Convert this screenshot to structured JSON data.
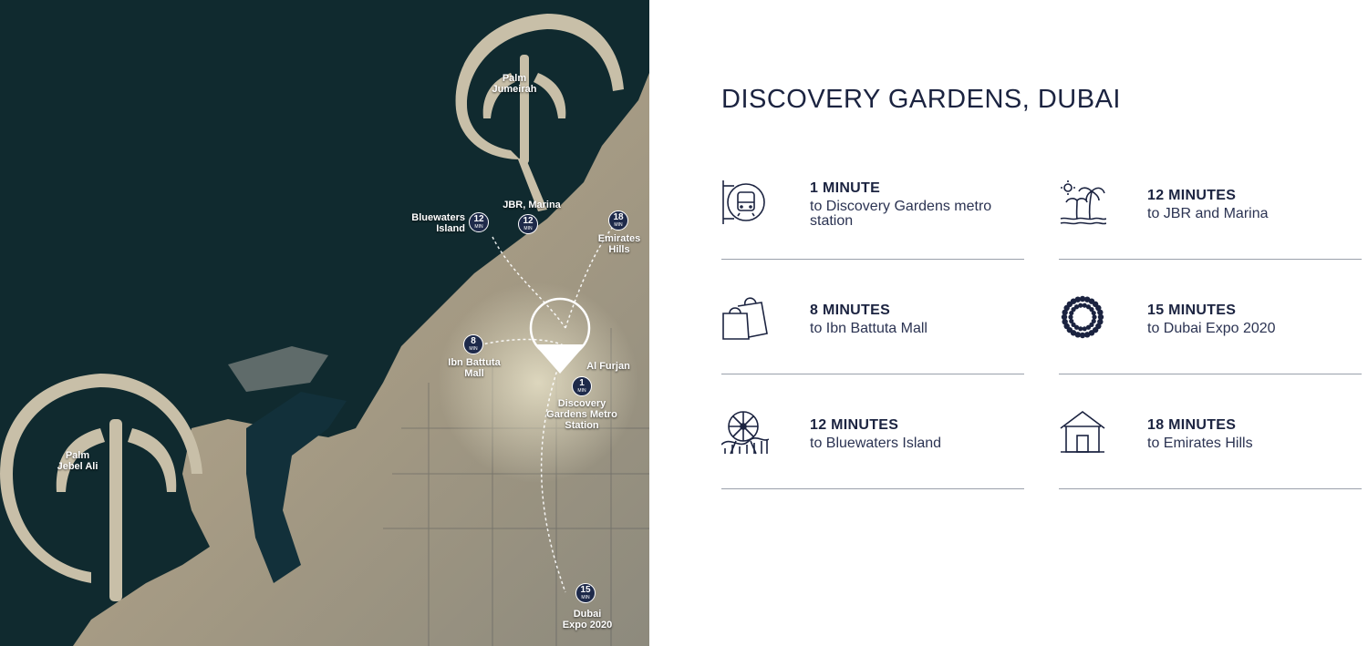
{
  "map": {
    "labels": {
      "palm_jumeirah": "Palm\nJumeirah",
      "jbr_marina": "JBR, Marina",
      "bluewaters": "Bluewaters\nIsland",
      "emirates_hills": "Emirates\nHills",
      "ibn_battuta": "Ibn Battuta\nMall",
      "al_furjan": "Al Furjan",
      "discovery_metro": "Discovery\nGardens Metro\nStation",
      "palm_jebel_ali": "Palm\nJebel Ali",
      "dubai_expo": "Dubai\nExpo 2020"
    },
    "badges": {
      "bluewaters": {
        "num": "12",
        "unit": "MIN"
      },
      "jbr": {
        "num": "12",
        "unit": "MIN"
      },
      "emirates": {
        "num": "18",
        "unit": "MIN"
      },
      "ibn": {
        "num": "8",
        "unit": "MIN"
      },
      "metro": {
        "num": "1",
        "unit": "MIN"
      },
      "expo": {
        "num": "15",
        "unit": "MIN"
      }
    }
  },
  "panel": {
    "title": "DISCOVERY GARDENS, DUBAI",
    "items": [
      {
        "headline": "1 MINUTE",
        "desc": "to Discovery Gardens metro station",
        "icon": "metro-icon"
      },
      {
        "headline": "12 MINUTES",
        "desc": "to JBR and Marina",
        "icon": "beach-palm-icon"
      },
      {
        "headline": "8 MINUTES",
        "desc": "to Ibn Battuta Mall",
        "icon": "shopping-bags-icon"
      },
      {
        "headline": "15 MINUTES",
        "desc": "to Dubai Expo 2020",
        "icon": "expo-ring-icon"
      },
      {
        "headline": "12 MINUTES",
        "desc": "to Bluewaters Island",
        "icon": "ferris-wheel-icon"
      },
      {
        "headline": "18 MINUTES",
        "desc": "to Emirates Hills",
        "icon": "house-icon"
      }
    ]
  },
  "colors": {
    "navy": "#1b2340",
    "sea": "#0f2a2e",
    "land": "#b9a98c",
    "badge": "#1e2a4a",
    "rule": "#9aa0ab"
  }
}
